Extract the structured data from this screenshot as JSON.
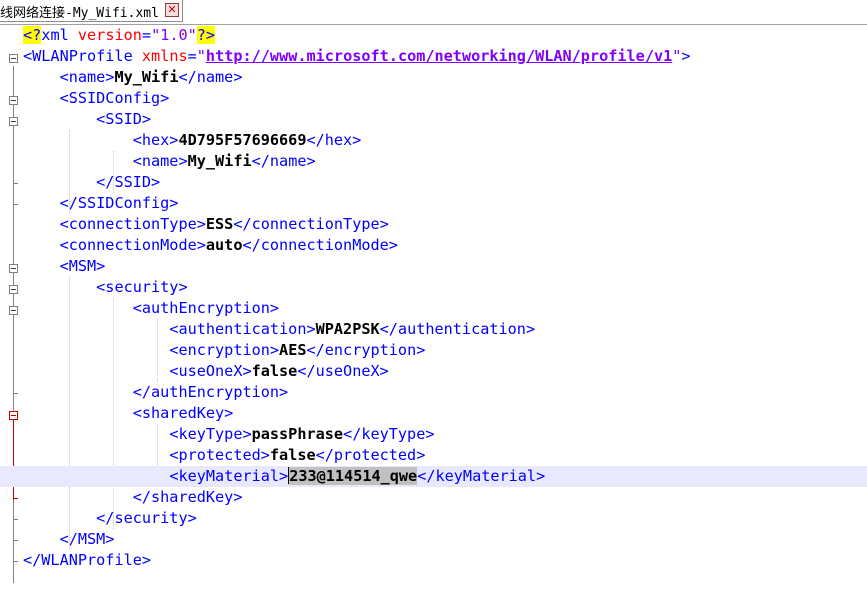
{
  "tab": {
    "title": "线网络连接-My_Wifi.xml",
    "close_icon": "close-icon"
  },
  "xml": {
    "decl_open": "<?",
    "decl_xml": "xml",
    "decl_version_attr": "version",
    "decl_version_value": "\"1.0\"",
    "decl_close": "?>",
    "root_open": "<WLANProfile",
    "root_xmlns_attr": "xmlns",
    "root_xmlns_url": "http://www.microsoft.com/networking/WLAN/profile/v1",
    "root_close": "</WLANProfile>",
    "name_open": "<name>",
    "name_value": "My_Wifi",
    "name_close": "</name>",
    "ssidconfig_open": "<SSIDConfig>",
    "ssid_open": "<SSID>",
    "hex_open": "<hex>",
    "hex_value": "4D795F57696669",
    "hex_close": "</hex>",
    "ssid_name_value": "My_Wifi",
    "ssid_close": "</SSID>",
    "ssidconfig_close": "</SSIDConfig>",
    "conntype_open": "<connectionType>",
    "conntype_value": "ESS",
    "conntype_close": "</connectionType>",
    "connmode_open": "<connectionMode>",
    "connmode_value": "auto",
    "connmode_close": "</connectionMode>",
    "msm_open": "<MSM>",
    "security_open": "<security>",
    "authenc_open": "<authEncryption>",
    "auth_open": "<authentication>",
    "auth_value": "WPA2PSK",
    "auth_close": "</authentication>",
    "enc_open": "<encryption>",
    "enc_value": "AES",
    "enc_close": "</encryption>",
    "useonex_open": "<useOneX>",
    "useonex_value": "false",
    "useonex_close": "</useOneX>",
    "authenc_close": "</authEncryption>",
    "sharedkey_open": "<sharedKey>",
    "keytype_open": "<keyType>",
    "keytype_value": "passPhrase",
    "keytype_close": "</keyType>",
    "protected_open": "<protected>",
    "protected_value": "false",
    "protected_close": "</protected>",
    "keymat_open": "<keyMaterial>",
    "keymat_value": "233@114514_qwe",
    "keymat_close": "</keyMaterial>",
    "sharedkey_close": "</sharedKey>",
    "security_close": "</security>",
    "msm_close": "</MSM>"
  },
  "colors": {
    "tag": "#0000ff",
    "attribute": "#ff0000",
    "value": "#8000ff",
    "current_line": "#e8e8ff",
    "selection": "#c0c0c0",
    "decl_highlight": "#ffff00"
  }
}
